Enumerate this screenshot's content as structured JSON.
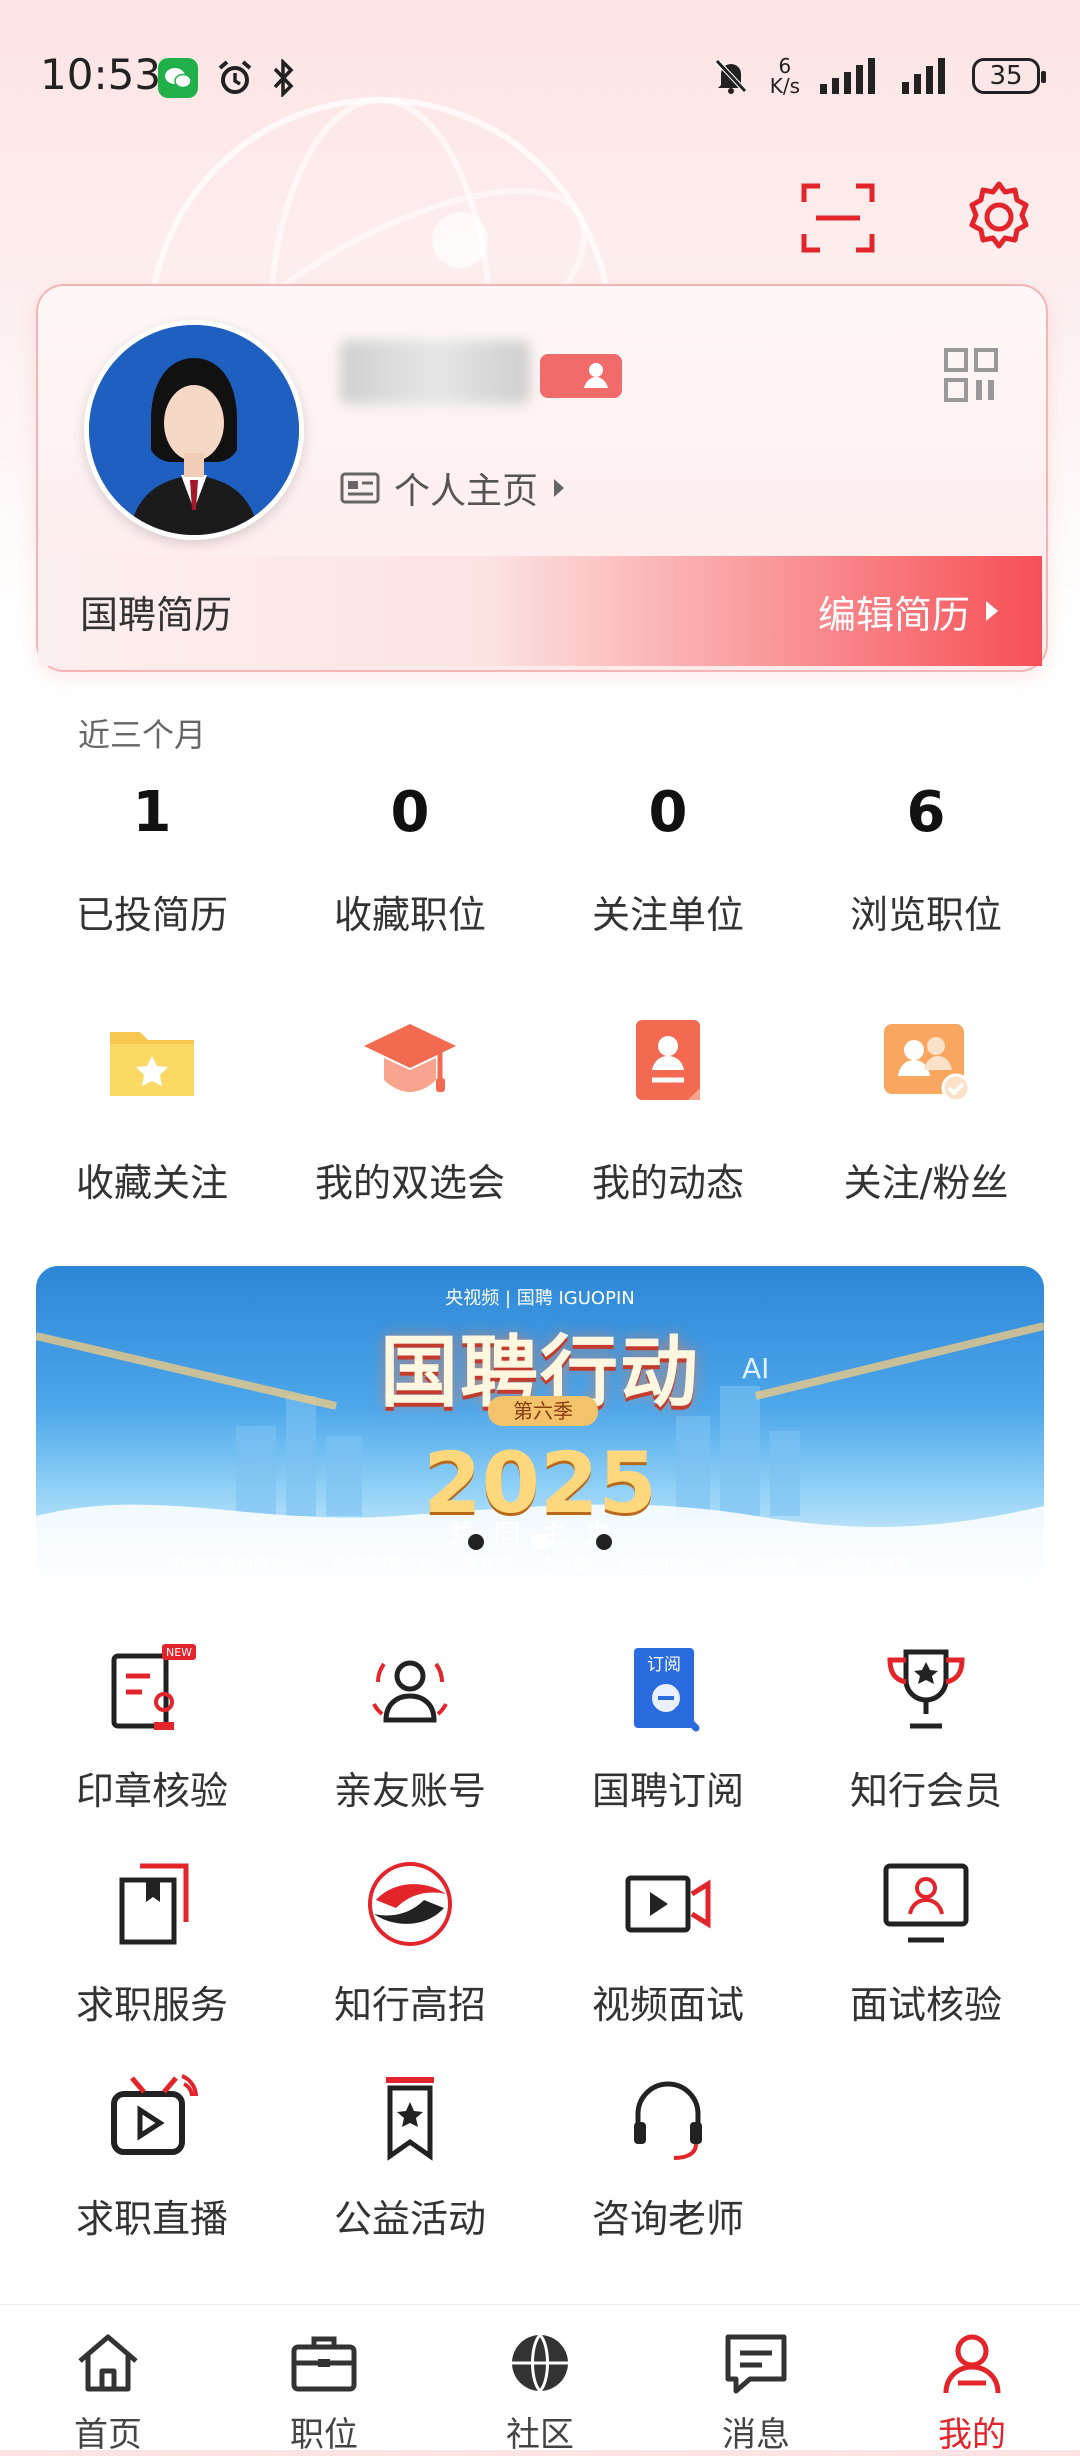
{
  "status_bar": {
    "time": "10:53",
    "speed_value": "6",
    "speed_unit": "K/s",
    "battery": "35"
  },
  "profile": {
    "homepage_label": "个人主页",
    "resume_title": "国聘简历",
    "edit_resume": "编辑简历"
  },
  "stats": {
    "period": "近三个月",
    "items": [
      {
        "value": "1",
        "label": "已投简历"
      },
      {
        "value": "0",
        "label": "收藏职位"
      },
      {
        "value": "0",
        "label": "关注单位"
      },
      {
        "value": "6",
        "label": "浏览职位"
      }
    ]
  },
  "quick": [
    {
      "label": "收藏关注",
      "icon": "folder-star-icon"
    },
    {
      "label": "我的双选会",
      "icon": "graduation-cap-icon"
    },
    {
      "label": "我的动态",
      "icon": "profile-doc-icon"
    },
    {
      "label": "关注/粉丝",
      "icon": "people-check-icon"
    }
  ],
  "banner": {
    "brand": "央视频 | 国聘 IGUOPIN",
    "title": "国聘行动",
    "season": "第六季",
    "year": "2025",
    "subtitle": "共同主办",
    "orgs": "中央广播电视总台 国务院国资委 教育部 人社部 共青团中央 全国妇联 全国工商联",
    "badge_ai": "AI"
  },
  "services": [
    {
      "label": "印章核验",
      "icon": "seal-verify-icon",
      "badge": "NEW"
    },
    {
      "label": "亲友账号",
      "icon": "family-account-icon"
    },
    {
      "label": "国聘订阅",
      "icon": "subscription-icon",
      "tag": "订阅"
    },
    {
      "label": "知行会员",
      "icon": "trophy-icon"
    },
    {
      "label": "求职服务",
      "icon": "job-service-icon"
    },
    {
      "label": "知行高招",
      "icon": "gaozhao-logo-icon"
    },
    {
      "label": "视频面试",
      "icon": "video-interview-icon"
    },
    {
      "label": "面试核验",
      "icon": "interview-verify-icon"
    },
    {
      "label": "求职直播",
      "icon": "live-tv-icon"
    },
    {
      "label": "公益活动",
      "icon": "ribbon-star-icon"
    },
    {
      "label": "咨询老师",
      "icon": "headset-icon"
    }
  ],
  "tabs": [
    {
      "label": "首页",
      "icon": "home-icon"
    },
    {
      "label": "职位",
      "icon": "briefcase-icon"
    },
    {
      "label": "社区",
      "icon": "globe-icon"
    },
    {
      "label": "消息",
      "icon": "message-icon"
    },
    {
      "label": "我的",
      "icon": "user-icon",
      "active": true
    }
  ],
  "colors": {
    "accent": "#e3242b",
    "icon_orange": "#f26a4f"
  }
}
